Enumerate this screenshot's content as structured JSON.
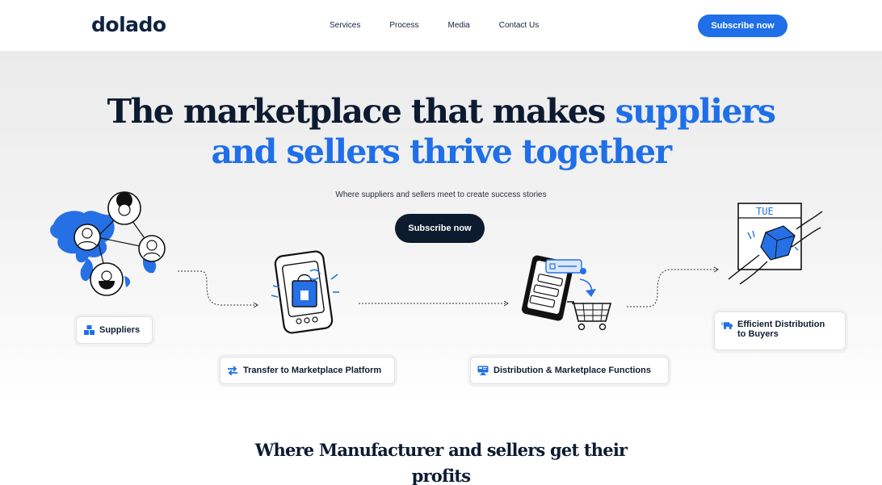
{
  "brand": {
    "logo": "dolado",
    "accent": "#1f6fe8",
    "dark": "#0d1b2e"
  },
  "nav": {
    "items": [
      "Services",
      "Process",
      "Media",
      "Contact Us"
    ]
  },
  "header": {
    "cta": "Subscribe now"
  },
  "hero": {
    "title_line1_dark": "The marketplace that makes",
    "title_line1_blue": "suppliers",
    "title_line2_blue": "and sellers thrive together",
    "subtitle": "Where suppliers and sellers meet to create success stories",
    "cta": "Subscribe now"
  },
  "steps": {
    "suppliers": "Suppliers",
    "transfer": "Transfer to Marketplace Platform",
    "distribution": "Distribution & Marketplace Functions",
    "efficient_line1": "Efficient Distribution",
    "efficient_line2": "to Buyers"
  },
  "illustrations": {
    "calendar_label": "TUE"
  },
  "section": {
    "title_line1": "Where Manufacturer and sellers get their",
    "title_line2": "profits"
  }
}
